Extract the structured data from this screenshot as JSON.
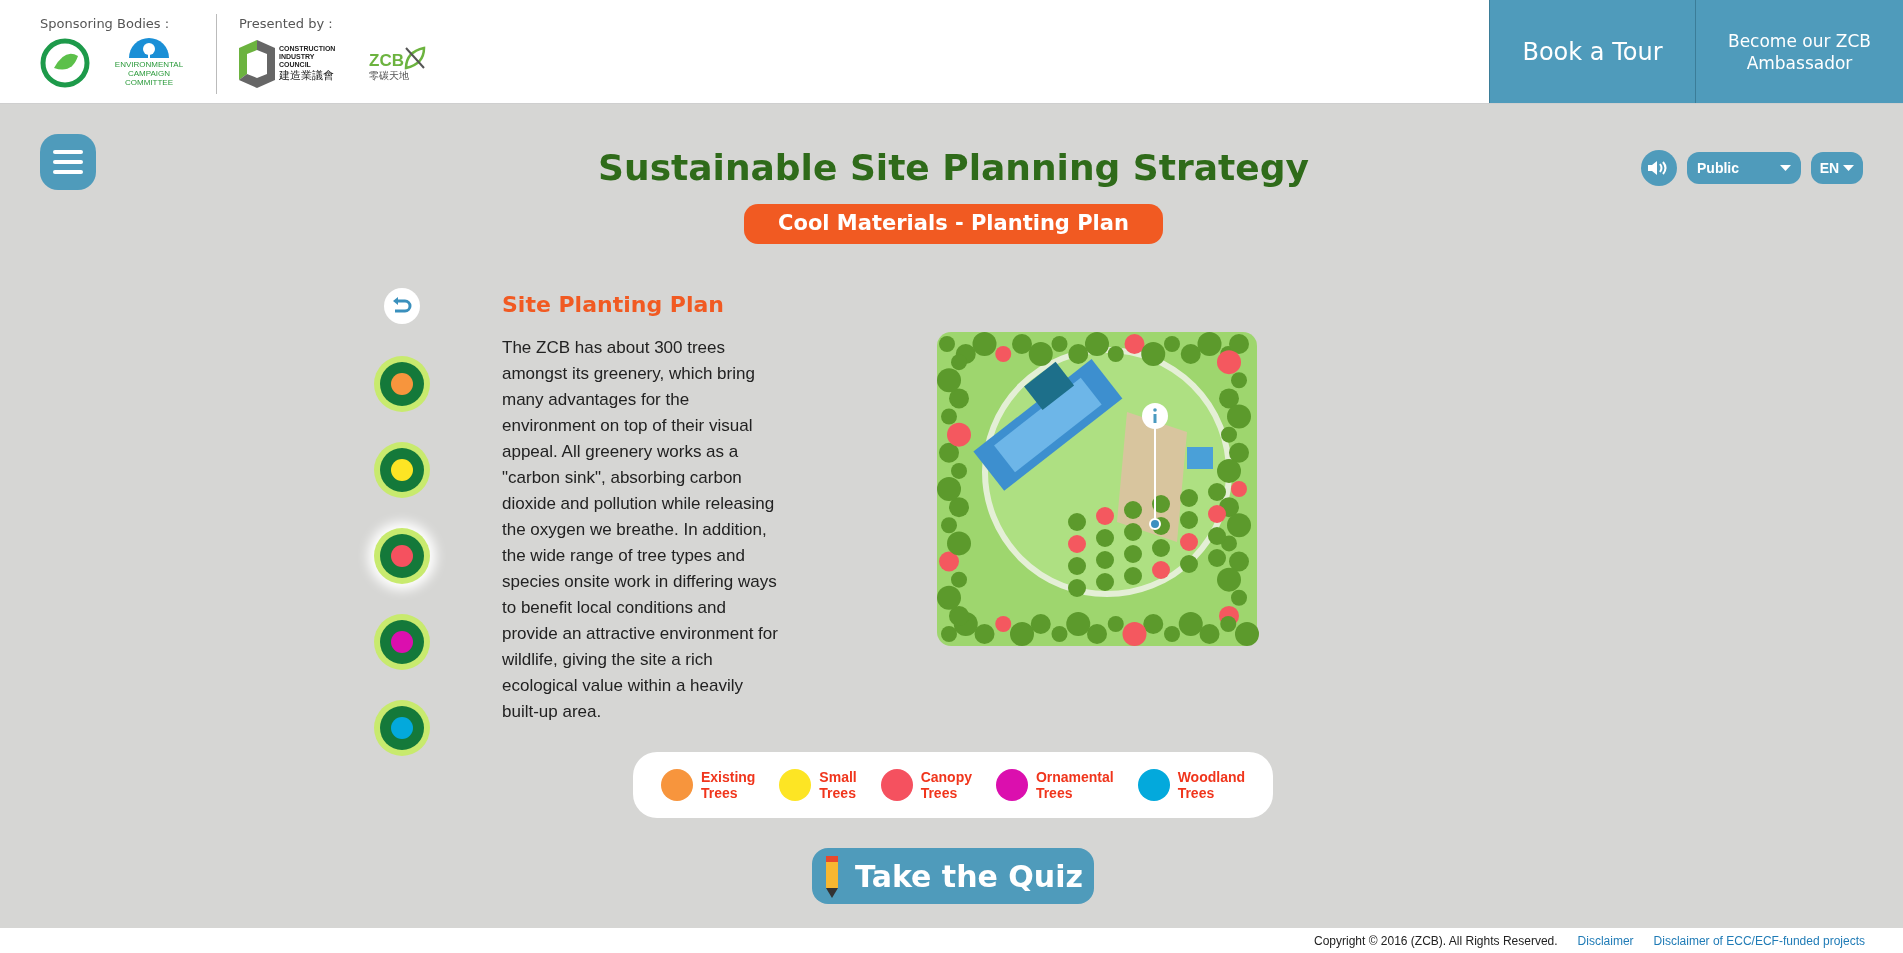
{
  "header": {
    "sponsors_label": "Sponsoring Bodies :",
    "sponsor_logos": [
      {
        "kind": "ring"
      },
      {
        "kind": "tree",
        "text": "ENVIRONMENTAL CAMPAIGN COMMITTEE"
      }
    ],
    "presented_label": "Presented by :",
    "presenter_logos": [
      {
        "kind": "cic",
        "text": "CONSTRUCTION INDUSTRY COUNCIL",
        "subtext": "建造業議會"
      },
      {
        "kind": "zcb",
        "text": "ZCB",
        "subtext": "零碳天地"
      }
    ],
    "nav_buttons": [
      {
        "label": "Book a Tour"
      },
      {
        "label": "Become our ZCB Ambassador"
      }
    ]
  },
  "title": "Sustainable Site Planning Strategy",
  "subtitle": "Cool Materials - Planting Plan",
  "controls": {
    "audience": {
      "value": "Public"
    },
    "language": {
      "value": "EN"
    }
  },
  "tree_buttons": [
    {
      "color": "#f7953d",
      "selected": false
    },
    {
      "color": "#fde524",
      "selected": false
    },
    {
      "color": "#f5515f",
      "selected": true
    },
    {
      "color": "#db0fae",
      "selected": false
    },
    {
      "color": "#03a9dc",
      "selected": false
    }
  ],
  "panel": {
    "heading": "Site Planting Plan",
    "body": "The ZCB has about 300 trees amongst its greenery, which bring many advantages for the environment on top of their visual appeal. All greenery works as a \"carbon sink\", absorbing carbon dioxide and pollution while releasing the oxygen we breathe. In addition, the wide range of tree types and species onsite work in differing ways to benefit local conditions and provide an attractive environment for wildlife, giving the site a rich ecological value within a heavily built-up area."
  },
  "legend": [
    {
      "label": "Existing Trees",
      "color": "#f7953d"
    },
    {
      "label": "Small Trees",
      "color": "#fde524"
    },
    {
      "label": "Canopy Trees",
      "color": "#f5515f"
    },
    {
      "label": "Ornamental Trees",
      "color": "#db0fae"
    },
    {
      "label": "Woodland Trees",
      "color": "#03a9dc"
    }
  ],
  "quiz_button": "Take the Quiz",
  "footer": {
    "copyright": "Copyright © 2016 (ZCB). All Rights Reserved.",
    "links": [
      "Disclaimer",
      "Disclaimer of ECC/ECF-funded projects"
    ]
  }
}
